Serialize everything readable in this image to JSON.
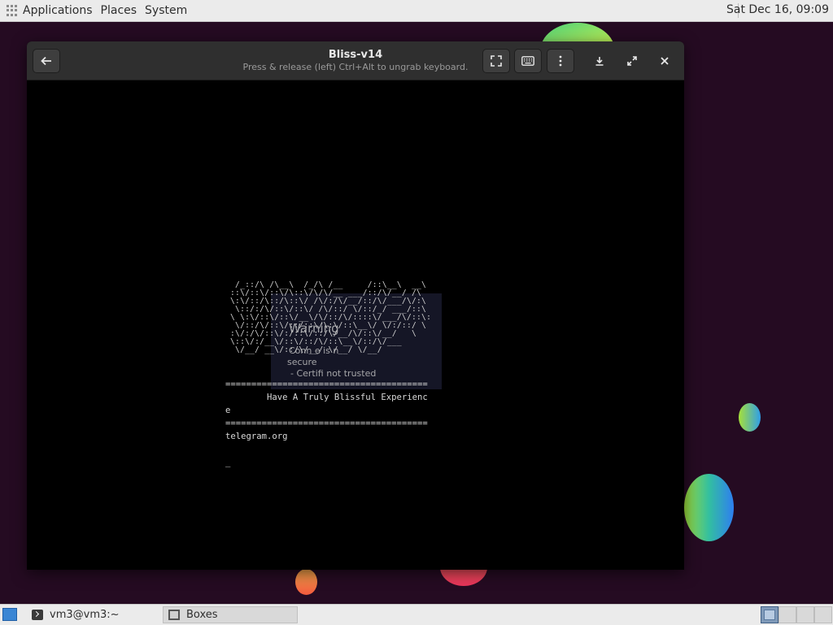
{
  "top_panel": {
    "menus": [
      "Applications",
      "Places",
      "System"
    ],
    "clock": "Sat Dec 16, 09:09"
  },
  "window": {
    "title": "Bliss-v14",
    "subtitle": "Press & release (left) Ctrl+Alt to ungrab keyboard.",
    "buttons": [
      "back-icon",
      "fullscreen-icon",
      "keyboard-icon",
      "menu-dots-icon",
      "download-icon",
      "expand-icon",
      "close-icon"
    ]
  },
  "vm_screen": {
    "dialog_ghost": {
      "title": "Warning",
      "line1": "Conn        e is n",
      "line2": "secure",
      "line3": "- Certifi        not trusted"
    },
    "separator": "=======================================",
    "message": "        Have A Truly Blissful Experienc",
    "message_wrap": "e",
    "url": "telegram.org",
    "cursor": "_"
  },
  "bottom_panel": {
    "tasks": [
      {
        "label": "vm3@vm3:~",
        "icon": "terminal-icon"
      },
      {
        "label": "Boxes",
        "icon": "boxes-icon"
      }
    ],
    "workspaces": 4,
    "active_workspace": 1
  },
  "colors": {
    "desktop": "#250b22",
    "headerbar": "#2f2f2f",
    "panel": "#ebebeb"
  }
}
